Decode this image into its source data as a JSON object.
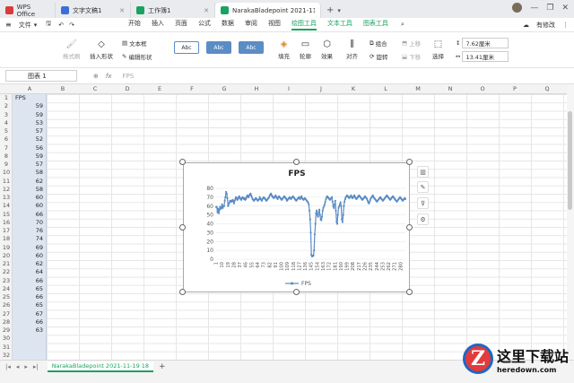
{
  "titlebar": {
    "tabs": [
      {
        "label": "WPS Office",
        "color": "#d93b3b"
      },
      {
        "label": "文字文稿1",
        "color": "#3a6fd8"
      },
      {
        "label": "工作簿1",
        "color": "#1aa260"
      },
      {
        "label": "NarakaBladepoint 2021-11-19 1",
        "color": "#1aa260"
      }
    ],
    "new_tab": "+"
  },
  "menubar": {
    "file": "文件",
    "items": [
      "开始",
      "插入",
      "页面",
      "公式",
      "数据",
      "审阅",
      "视图",
      "绘图工具",
      "文本工具",
      "图表工具"
    ],
    "active": "绘图工具",
    "share": "有修改"
  },
  "ribbon": {
    "format_brush": "格式刷",
    "insert_shape": "插入形状",
    "text_box": "文本框",
    "edit_shape": "编辑形状",
    "style_samples": [
      "Abc",
      "Abc",
      "Abc"
    ],
    "fill": "填充",
    "outline": "轮廓",
    "effect": "效果",
    "align": "对齐",
    "group": "组合",
    "rotate": "旋转",
    "move_up": "上移",
    "move_down": "下移",
    "select": "选择",
    "height": "7.62厘米",
    "width": "13.41厘米"
  },
  "formulabar": {
    "name_box": "图表 1",
    "fx": "fx",
    "content": "FPS"
  },
  "columns": [
    "A",
    "B",
    "C",
    "D",
    "E",
    "F",
    "G",
    "H",
    "I",
    "J",
    "K",
    "L",
    "M",
    "N",
    "O",
    "P",
    "Q"
  ],
  "rows": [
    "1",
    "2",
    "3",
    "4",
    "5",
    "6",
    "7",
    "8",
    "9",
    "10",
    "11",
    "12",
    "13",
    "14",
    "15",
    "16",
    "17",
    "18",
    "19",
    "20",
    "21",
    "22",
    "23",
    "24",
    "25",
    "26",
    "27",
    "28",
    "29",
    "30",
    "31",
    "32"
  ],
  "col_a": [
    "FPS",
    "59",
    "59",
    "53",
    "57",
    "52",
    "56",
    "59",
    "57",
    "58",
    "62",
    "58",
    "60",
    "60",
    "66",
    "70",
    "76",
    "74",
    "69",
    "60",
    "62",
    "64",
    "66",
    "65",
    "66",
    "65",
    "67",
    "66",
    "63"
  ],
  "sheet": {
    "tab": "NarakaBladepoint 2021-11-19 18",
    "add": "+"
  },
  "watermark": {
    "main": "这里下载站",
    "sub": "heredown.com",
    "letter": "Z"
  },
  "chart_data": {
    "type": "line",
    "title": "FPS",
    "legend": "FPS",
    "legend_position": "bottom",
    "ylim": [
      0,
      80
    ],
    "yticks": [
      0,
      10,
      20,
      30,
      40,
      50,
      60,
      70,
      80
    ],
    "xticks": [
      "1",
      "10",
      "19",
      "28",
      "37",
      "46",
      "55",
      "64",
      "73",
      "82",
      "91",
      "100",
      "109",
      "118",
      "127",
      "136",
      "145",
      "154",
      "163",
      "172",
      "181",
      "190",
      "199",
      "208",
      "217",
      "226",
      "235",
      "244",
      "253",
      "262",
      "271",
      "280"
    ],
    "grid": true,
    "color": "#5b8cc4",
    "values": [
      59,
      59,
      53,
      57,
      52,
      56,
      59,
      57,
      58,
      62,
      58,
      60,
      60,
      66,
      70,
      76,
      74,
      69,
      60,
      62,
      64,
      66,
      65,
      66,
      65,
      67,
      66,
      63,
      66,
      68,
      70,
      69,
      67,
      68,
      70,
      71,
      69,
      68,
      67,
      69,
      70,
      69,
      68,
      69,
      67,
      68,
      70,
      72,
      71,
      70,
      72,
      73,
      74,
      72,
      70,
      68,
      67,
      66,
      67,
      68,
      69,
      68,
      67,
      66,
      67,
      68,
      70,
      68,
      67,
      66,
      68,
      69,
      70,
      69,
      68,
      67,
      66,
      67,
      68,
      69,
      70,
      72,
      73,
      74,
      72,
      71,
      70,
      69,
      70,
      71,
      72,
      70,
      69,
      68,
      70,
      71,
      70,
      69,
      68,
      67,
      68,
      69,
      70,
      71,
      70,
      69,
      68,
      66,
      67,
      68,
      69,
      70,
      69,
      68,
      69,
      70,
      71,
      70,
      69,
      68,
      67,
      66,
      67,
      68,
      69,
      70,
      69,
      68,
      70,
      71,
      69,
      68,
      67,
      68,
      69,
      68,
      67,
      66,
      65,
      64,
      62,
      55,
      45,
      30,
      5,
      3,
      4,
      4,
      10,
      28,
      40,
      52,
      55,
      50,
      48,
      53,
      56,
      50,
      45,
      44,
      48,
      55,
      58,
      60,
      62,
      65,
      68,
      70,
      71,
      70,
      69,
      68,
      67,
      68,
      69,
      70,
      65,
      60,
      58,
      62,
      66,
      55,
      42,
      40,
      50,
      58,
      60,
      62,
      64,
      60,
      45,
      42,
      50,
      60,
      65,
      68,
      70,
      71,
      72,
      71,
      70,
      69,
      70,
      71,
      72,
      70,
      69,
      70,
      71,
      72,
      70,
      69,
      68,
      69,
      70,
      71,
      72,
      71,
      70,
      69,
      68,
      67,
      68,
      69,
      70,
      71,
      70,
      69,
      68,
      66,
      64,
      63,
      65,
      67,
      69,
      70,
      71,
      72,
      70,
      69,
      68,
      67,
      66,
      65,
      66,
      67,
      68,
      69,
      70,
      69,
      68,
      67,
      66,
      67,
      68,
      69,
      70,
      71,
      72,
      71,
      70,
      69,
      68,
      67,
      68,
      69,
      70,
      71,
      70,
      69,
      68,
      67,
      66,
      65,
      66,
      67,
      68,
      69,
      70,
      69,
      68,
      67,
      66,
      67,
      68,
      69,
      68
    ]
  }
}
